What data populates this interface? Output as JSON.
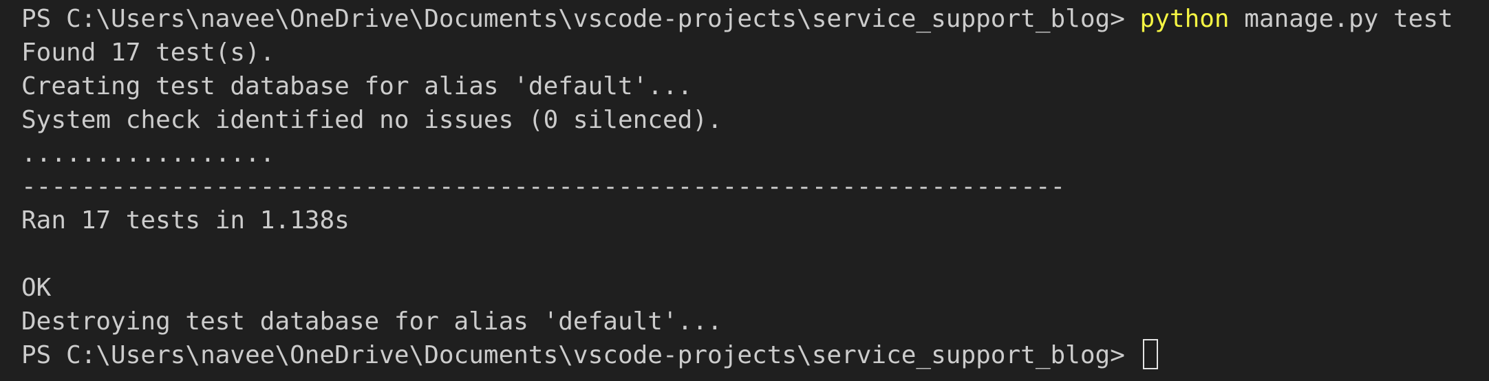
{
  "terminal": {
    "prompt_path": "PS C:\\Users\\navee\\OneDrive\\Documents\\vscode-projects\\service_support_blog> ",
    "command_keyword": "python",
    "command_args": " manage.py test",
    "lines": [
      "Found 17 test(s).",
      "Creating test database for alias 'default'...",
      "System check identified no issues (0 silenced).",
      ".................",
      "----------------------------------------------------------------------",
      "Ran 17 tests in 1.138s",
      "",
      "OK",
      "Destroying test database for alias 'default'..."
    ],
    "final_prompt": "PS C:\\Users\\navee\\OneDrive\\Documents\\vscode-projects\\service_support_blog> "
  },
  "colors": {
    "background": "#1f1f1f",
    "foreground": "#cccccc",
    "command_keyword": "#f5f543"
  }
}
